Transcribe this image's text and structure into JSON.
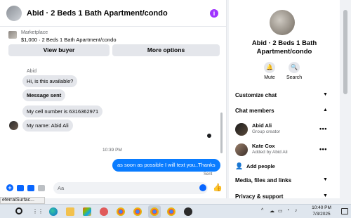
{
  "chat": {
    "title": "Abid · 2 Beds 1 Bath Apartment/condo",
    "info_icon": "i",
    "marketplace": {
      "label": "Marketplace",
      "price_line": "$1,000 · 2 Beds 1 Bath Apartment/condo",
      "view_buyer": "View buyer",
      "more_options": "More options"
    },
    "sender_name": "Abid",
    "messages": [
      {
        "text": "Hi, is this available?",
        "bold": false
      },
      {
        "text": "Message sent",
        "bold": true
      },
      {
        "text": "My cell number is 6316362971",
        "bold": false
      },
      {
        "text": "My name: Abid Ali",
        "bold": false
      }
    ],
    "time": "10:39 PM",
    "outgoing": "as soon as possible I will text you..Thanks",
    "sent_label": "Sent",
    "composer_placeholder": "Aa"
  },
  "status_tooltip": "eferralSurfac...",
  "right_panel": {
    "title": "Abid · 2 Beds 1 Bath Apartment/condo",
    "mute": "Mute",
    "search": "Search",
    "customize_chat": "Customize chat",
    "chat_members": "Chat members",
    "members": [
      {
        "name": "Abid Ali",
        "role": "Group creator"
      },
      {
        "name": "Kate Cox",
        "role": "Added by Abid Ali"
      }
    ],
    "add_people": "Add people",
    "media_files_links": "Media, files and links",
    "privacy_support": "Privacy & support"
  },
  "taskbar": {
    "clock_time": "10:40 PM",
    "clock_date": "7/3/2025"
  },
  "icons": {
    "info": "info-icon",
    "mute": "bell-icon",
    "search": "search-icon",
    "add_people": "add-person-icon",
    "more": "more-dots-icon",
    "like": "thumbs-up-icon"
  },
  "colors": {
    "accent": "#0866ff",
    "outgoing_bubble": "#0a7cff",
    "info": "#a033ff"
  }
}
